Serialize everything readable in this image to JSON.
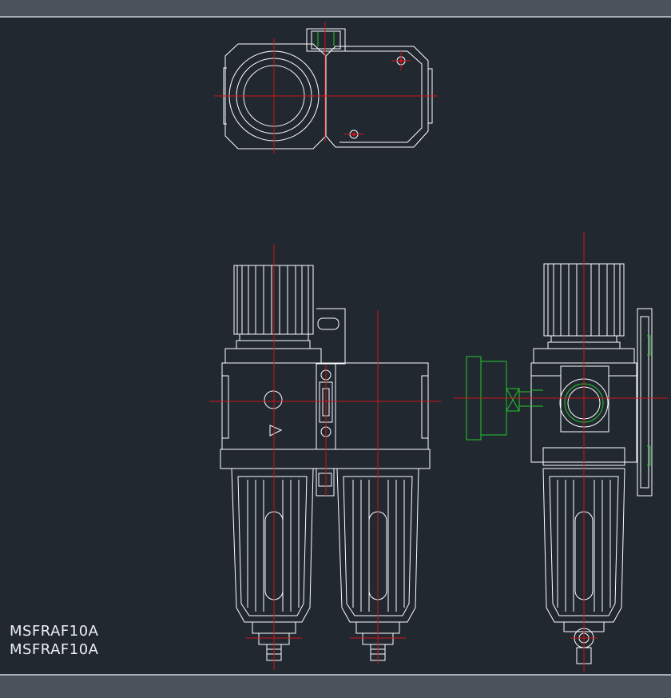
{
  "drawing": {
    "labels": [
      "MSFRAF10A",
      "MSFRAF10A"
    ]
  },
  "colors": {
    "background": "#212830",
    "linework": "#ffffff",
    "centerline": "#d01418",
    "gauge": "#22c82a",
    "bar": "#4a525c"
  }
}
